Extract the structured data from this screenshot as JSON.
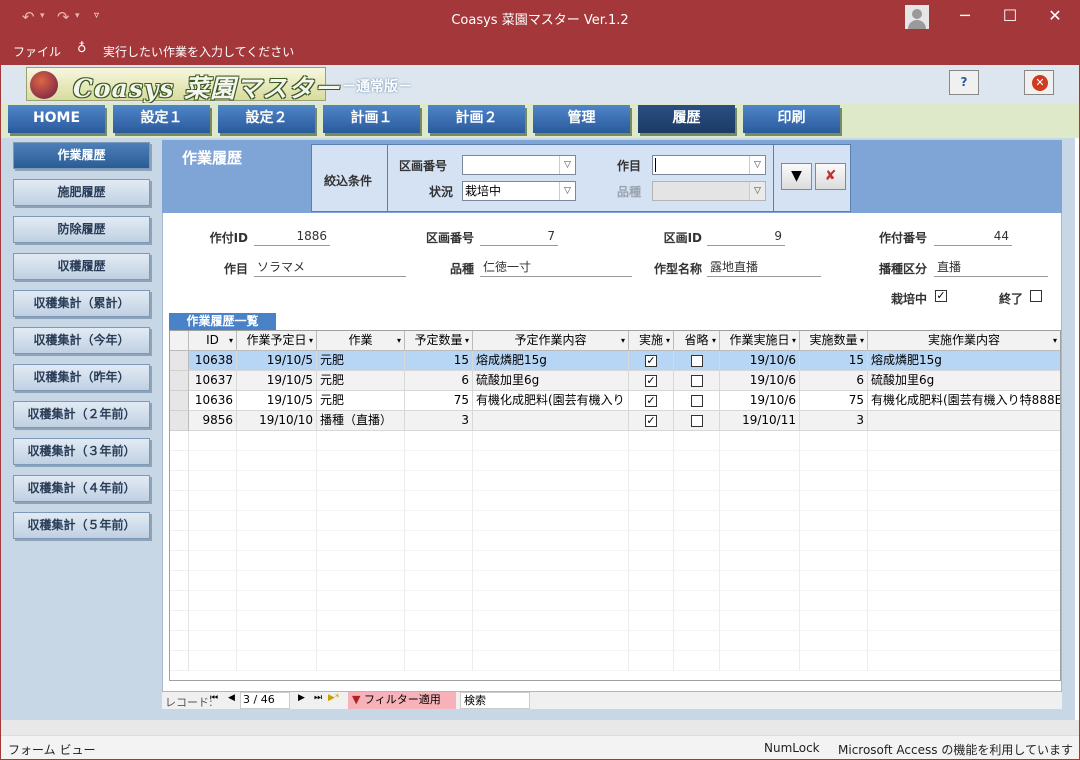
{
  "window": {
    "title": "Coasys 菜園マスター Ver.1.2"
  },
  "ribbon": {
    "file": "ファイル",
    "tell_me": "実行したい作業を入力してください"
  },
  "header": {
    "logo_text": "Coasys 菜園マスター",
    "edition": "－通常版－",
    "help_label": "?"
  },
  "tabs": [
    "HOME",
    "設定１",
    "設定２",
    "計画１",
    "計画２",
    "管理",
    "履歴",
    "印刷"
  ],
  "active_tab": "履歴",
  "sidebar": [
    "作業履歴",
    "施肥履歴",
    "防除履歴",
    "収穫履歴",
    "収穫集計（累計）",
    "収穫集計（今年）",
    "収穫集計（昨年）",
    "収穫集計（２年前）",
    "収穫集計（３年前）",
    "収穫集計（４年前）",
    "収穫集計（５年前）"
  ],
  "page_title": "作業履歴",
  "filter": {
    "section_label": "絞込条件",
    "plot_label": "区画番号",
    "plot_value": "",
    "status_label": "状況",
    "status_value": "栽培中",
    "crop_label": "作目",
    "crop_value": "",
    "variety_label": "品種",
    "variety_value": ""
  },
  "detail": {
    "planting_id_label": "作付ID",
    "planting_id": "1886",
    "plot_no_label": "区画番号",
    "plot_no": "7",
    "plot_id_label": "区画ID",
    "plot_id": "9",
    "planting_no_label": "作付番号",
    "planting_no": "44",
    "crop_label": "作目",
    "crop": "ソラマメ",
    "variety_label": "品種",
    "variety": "仁徳一寸",
    "type_label": "作型名称",
    "type": "露地直播",
    "sowing_label": "播種区分",
    "sowing": "直播",
    "growing_label": "栽培中",
    "growing_checked": true,
    "finished_label": "終了",
    "finished_checked": false
  },
  "table": {
    "label": "作業履歴一覧",
    "columns": [
      "ID",
      "作業予定日",
      "作業",
      "予定数量",
      "予定作業内容",
      "実施",
      "省略",
      "作業実施日",
      "実施数量",
      "実施作業内容"
    ],
    "rows": [
      {
        "id": "10638",
        "plan_date": "19/10/5",
        "work": "元肥",
        "plan_qty": "15",
        "plan_content": "熔成燐肥15g",
        "done": true,
        "skip": false,
        "done_date": "19/10/6",
        "done_qty": "15",
        "done_content": "熔成燐肥15g"
      },
      {
        "id": "10637",
        "plan_date": "19/10/5",
        "work": "元肥",
        "plan_qty": "6",
        "plan_content": "硫酸加里6g",
        "done": true,
        "skip": false,
        "done_date": "19/10/6",
        "done_qty": "6",
        "done_content": "硫酸加里6g"
      },
      {
        "id": "10636",
        "plan_date": "19/10/5",
        "work": "元肥",
        "plan_qty": "75",
        "plan_content": "有機化成肥料(園芸有機入り",
        "done": true,
        "skip": false,
        "done_date": "19/10/6",
        "done_qty": "75",
        "done_content": "有機化成肥料(園芸有機入り特888E"
      },
      {
        "id": "9856",
        "plan_date": "19/10/10",
        "work": "播種（直播）",
        "plan_qty": "3",
        "plan_content": "",
        "done": true,
        "skip": false,
        "done_date": "19/10/11",
        "done_qty": "3",
        "done_content": ""
      }
    ]
  },
  "record_nav": {
    "label": "レコード:",
    "position": "3 / 46",
    "filter_label": "フィルター適用",
    "search_label": "検索"
  },
  "statusbar": {
    "left": "フォーム ビュー",
    "numlock": "NumLock",
    "right": "Microsoft Access の機能を利用しています"
  }
}
